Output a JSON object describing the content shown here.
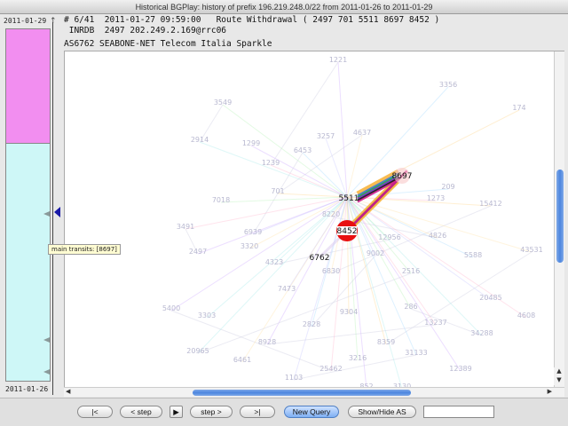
{
  "window": {
    "title": "Historical BGPlay: history of prefix 196.219.248.0/22 from 2011-01-26 to 2011-01-29"
  },
  "timeline": {
    "start_label": "2011-01-29",
    "end_label": "2011-01-26",
    "tooltip": "main transits: [8697]"
  },
  "info": {
    "line1": "# 6/41  2011-01-27 09:59:00   Route Withdrawal ( 2497 701 5511 8697 8452 )",
    "line2": " INRDB  2497 202.249.2.169@rrc06",
    "line3": "AS6762 SEABONE-NET Telecom Italia Sparkle"
  },
  "graph": {
    "highlighted_nodes": [
      {
        "label": "8697"
      },
      {
        "label": "5511"
      },
      {
        "label": "8452"
      },
      {
        "label": "6762"
      }
    ],
    "faint_nodes": [
      "1221",
      "3356",
      "174",
      "3549",
      "1239",
      "3257",
      "4637",
      "2914",
      "1299",
      "6453",
      "701",
      "7018",
      "3491",
      "6939",
      "3320",
      "4323",
      "2497",
      "209",
      "15412",
      "12956",
      "1273",
      "9002",
      "6830",
      "3303",
      "8928",
      "2828",
      "9304",
      "286",
      "13237",
      "20485",
      "43531",
      "34288",
      "12389",
      "31133",
      "8359",
      "3216",
      "25462",
      "1103",
      "6461",
      "20965",
      "5400",
      "5588",
      "8220",
      "2516",
      "4608",
      "7473",
      "4826",
      "3130",
      "852"
    ]
  },
  "toolbar": {
    "first_label": "|<",
    "prev_label": "< step",
    "play_icon": "play-icon",
    "next_label": "step >",
    "last_label": ">|",
    "new_query_label": "New Query",
    "show_hide_label": "Show/Hide AS",
    "search_value": ""
  },
  "colors": {
    "pink": "#f28ef0",
    "cyan": "#cef7f7",
    "accent": "#4c86df",
    "node_red": "#e81010"
  }
}
